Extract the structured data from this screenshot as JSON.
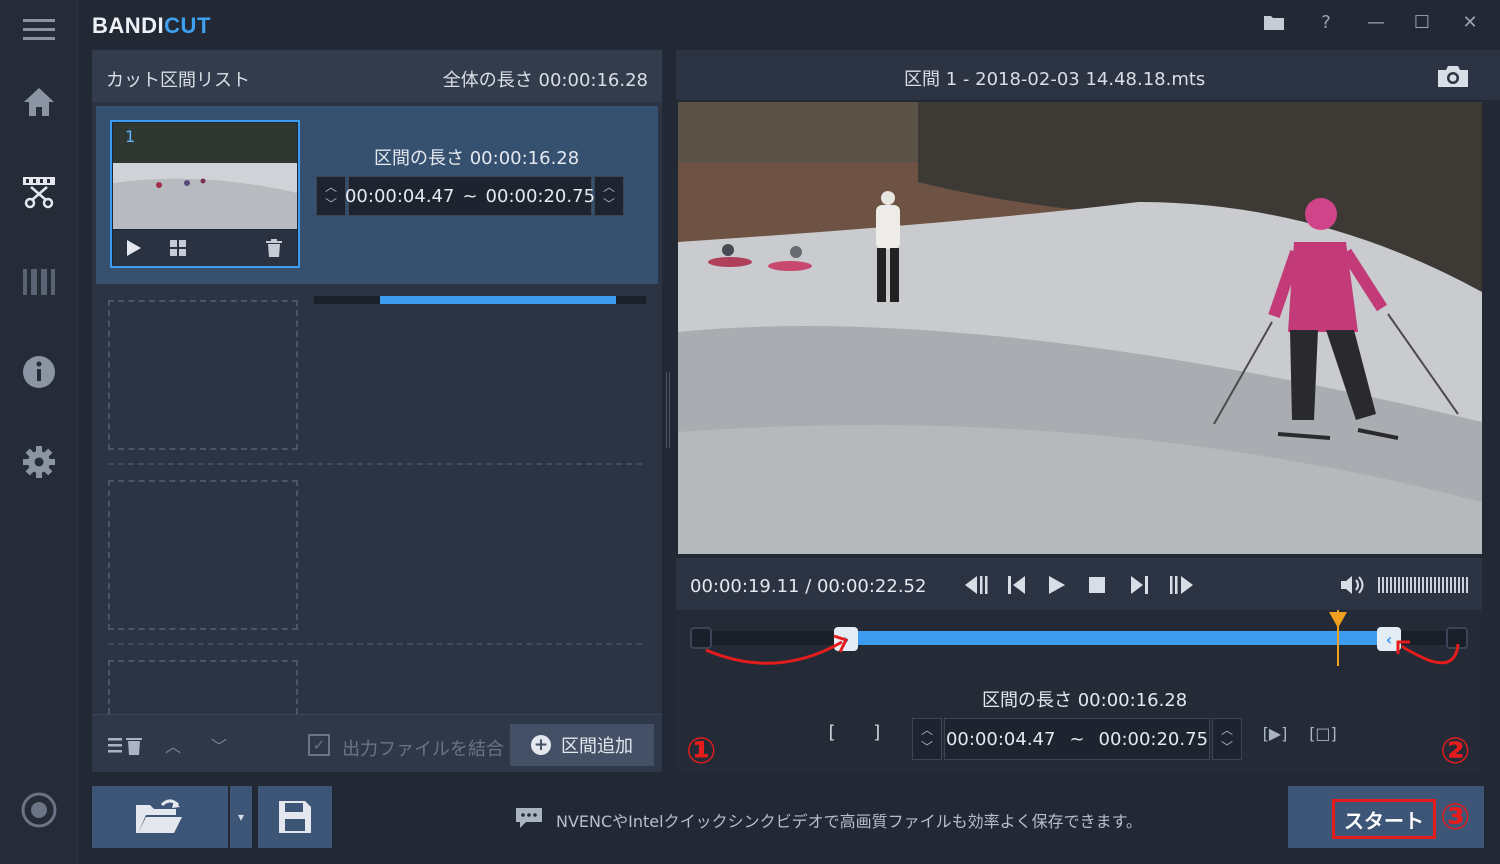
{
  "app": {
    "brand_prefix": "BANDI",
    "brand_suffix": "CUT",
    "accent": "#3d9bf0",
    "annotation_color": "#e41c1c"
  },
  "sidebar": {
    "items": [
      {
        "icon": "menu-icon"
      },
      {
        "icon": "home-icon"
      },
      {
        "icon": "cut-icon",
        "active": true
      },
      {
        "icon": "film-icon"
      },
      {
        "icon": "info-icon"
      },
      {
        "icon": "gear-icon"
      },
      {
        "icon": "record-icon"
      }
    ]
  },
  "window_controls": {
    "folder": "folder-icon",
    "help": "?",
    "minimize": "—",
    "maximize": "☐",
    "close": "✕"
  },
  "segment_list": {
    "title": "カット区間リスト",
    "total_length": "全体の長さ 00:00:16.28",
    "segments": [
      {
        "number": "1",
        "length_label": "区間の長さ 00:00:16.28",
        "start": "00:00:04.47",
        "separator": "~",
        "end": "00:00:20.75",
        "progress_start_fraction": 0.2,
        "progress_end_fraction": 0.91
      }
    ],
    "footer": {
      "merge_label": "出力ファイルを結合",
      "merge_checked": true,
      "add_button": "区間追加"
    }
  },
  "preview": {
    "title": "区間 1 - 2018-02-03 14.48.18.mts",
    "time": "00:00:19.11 / 00:00:22.52",
    "timeline": {
      "selection_start_fraction": 0.2,
      "selection_end_fraction": 0.915,
      "playhead_fraction": 0.848
    },
    "length_label": "区間の長さ 00:00:16.28",
    "start": "00:00:04.47",
    "separator": "~",
    "end": "00:00:20.75",
    "bracket_open": "[",
    "bracket_close": "]",
    "play_segment_label": "[▶]",
    "square_label": "[□]"
  },
  "bottom": {
    "tip": "NVENCやIntelクイックシンクビデオで高画質ファイルも効率よく保存できます。",
    "start_button": "スタート"
  },
  "annotations": [
    "①",
    "②",
    "③"
  ]
}
